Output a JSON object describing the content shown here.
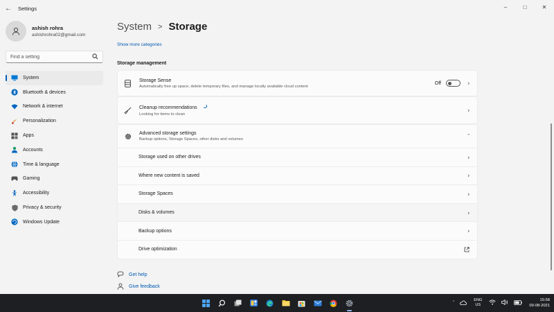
{
  "window": {
    "back_icon": "arrow-left-icon",
    "title": "Settings",
    "controls": [
      "minimize-icon",
      "maximize-icon",
      "close-icon"
    ]
  },
  "profile": {
    "name": "ashish rohra",
    "email": "ashishrohra02@gmail.com",
    "avatar_icon": "person-icon"
  },
  "search": {
    "placeholder": "Find a setting",
    "value": "",
    "icon": "search-icon"
  },
  "sidebar": {
    "items": [
      {
        "label": "System",
        "icon": "monitor-icon",
        "color": "#0078d4",
        "active": true
      },
      {
        "label": "Bluetooth & devices",
        "icon": "bluetooth-icon",
        "color": "#0067c0"
      },
      {
        "label": "Network & internet",
        "icon": "wifi-icon",
        "color": "#0067c0"
      },
      {
        "label": "Personalization",
        "icon": "brush-icon",
        "color": "#e8912d"
      },
      {
        "label": "Apps",
        "icon": "apps-icon",
        "color": "#505050"
      },
      {
        "label": "Accounts",
        "icon": "person-icon",
        "color": "#1f9a6a"
      },
      {
        "label": "Time & language",
        "icon": "globe-clock-icon",
        "color": "#0067c0"
      },
      {
        "label": "Gaming",
        "icon": "gamepad-icon",
        "color": "#505050"
      },
      {
        "label": "Accessibility",
        "icon": "accessibility-icon",
        "color": "#0067c0"
      },
      {
        "label": "Privacy & security",
        "icon": "shield-icon",
        "color": "#6b6b6b"
      },
      {
        "label": "Windows Update",
        "icon": "update-icon",
        "color": "#0067c0"
      }
    ]
  },
  "header": {
    "breadcrumb_parent": "System",
    "breadcrumb_separator": ">",
    "breadcrumb_current": "Storage"
  },
  "main": {
    "show_more": "Show more categories",
    "section_title": "Storage management",
    "storage_sense": {
      "title": "Storage Sense",
      "subtitle": "Automatically free up space, delete temporary files, and manage locally available cloud content",
      "toggle_label": "Off",
      "toggle_on": false
    },
    "cleanup": {
      "title": "Cleanup recommendations",
      "subtitle": "Looking for items to clean"
    },
    "advanced": {
      "title": "Advanced storage settings",
      "subtitle": "Backup options, Storage Spaces, other disks and volumes",
      "expanded": true,
      "items": [
        {
          "label": "Storage used on other drives",
          "action_icon": "chevron-right-icon"
        },
        {
          "label": "Where new content is saved",
          "action_icon": "chevron-right-icon"
        },
        {
          "label": "Storage Spaces",
          "action_icon": "chevron-right-icon"
        },
        {
          "label": "Disks & volumes",
          "action_icon": "chevron-right-icon",
          "hovered": true
        },
        {
          "label": "Backup options",
          "action_icon": "chevron-right-icon"
        },
        {
          "label": "Drive optimization",
          "action_icon": "external-link-icon"
        }
      ]
    },
    "help": [
      {
        "label": "Get help",
        "icon": "help-icon"
      },
      {
        "label": "Give feedback",
        "icon": "feedback-icon"
      }
    ]
  },
  "taskbar": {
    "apps": [
      "windows-start-icon",
      "search-icon",
      "task-view-icon",
      "widgets-icon",
      "edge-icon",
      "file-explorer-icon",
      "store-icon",
      "mail-icon",
      "chrome-icon",
      "settings-gear-icon"
    ],
    "active_app": "settings-gear-icon",
    "tray_icons": [
      "chevron-up-icon",
      "cloud-icon"
    ],
    "language_top": "ENG",
    "language_bottom": "US",
    "system_icons": [
      "wifi-icon",
      "speaker-icon",
      "battery-icon"
    ],
    "time": "15:58",
    "date": "09-08-2021"
  },
  "colors": {
    "accent": "#005fb8",
    "link": "#0058b0",
    "background": "#f3f3f3",
    "card": "#fbfbfb",
    "taskbar": "#1e1f22"
  }
}
